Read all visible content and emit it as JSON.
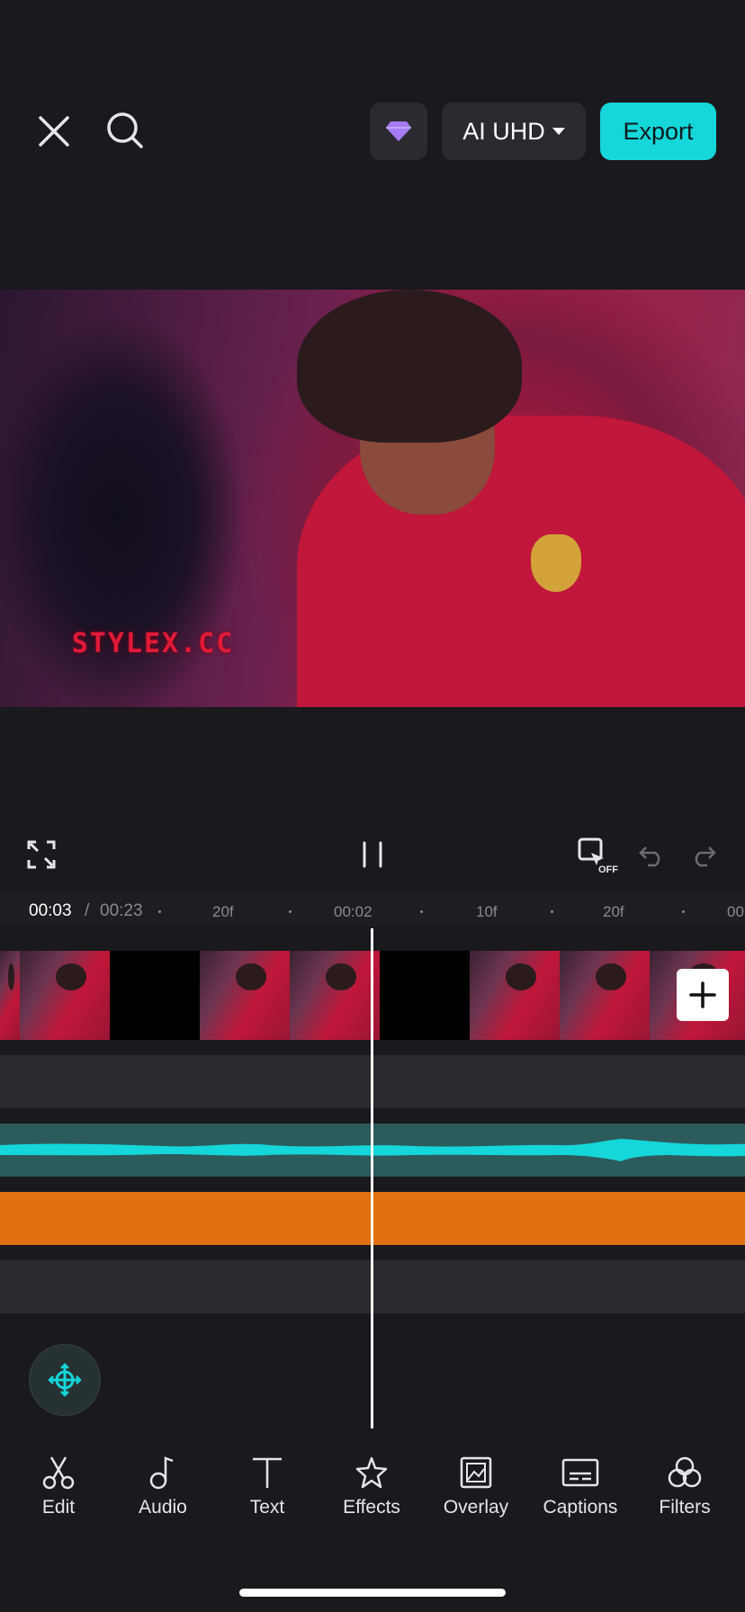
{
  "header": {
    "close_icon": "close-icon",
    "search_icon": "search-icon",
    "pro_icon": "diamond-icon",
    "quality_label": "AI UHD",
    "export_label": "Export"
  },
  "preview": {
    "watermark_text": "STYLEX.CC"
  },
  "playback": {
    "fullscreen_icon": "fullscreen-icon",
    "pause_icon": "pause-icon",
    "keyframe_toggle_icon": "keyframe-off-icon",
    "keyframe_toggle_state": "OFF",
    "undo_icon": "undo-icon",
    "redo_icon": "redo-icon"
  },
  "timeline": {
    "current_time": "00:03",
    "separator": "/",
    "total_time": "00:23",
    "ruler_labels": [
      "20f",
      "00:02",
      "10f",
      "20f",
      "00"
    ]
  },
  "toolbar": {
    "items": [
      {
        "label": "Edit",
        "icon": "scissors-icon"
      },
      {
        "label": "Audio",
        "icon": "music-note-icon"
      },
      {
        "label": "Text",
        "icon": "text-icon"
      },
      {
        "label": "Effects",
        "icon": "star-icon"
      },
      {
        "label": "Overlay",
        "icon": "overlay-icon"
      },
      {
        "label": "Captions",
        "icon": "captions-icon"
      },
      {
        "label": "Filters",
        "icon": "filters-icon"
      }
    ]
  },
  "colors": {
    "accent": "#15d6d9",
    "background": "#1a191e",
    "audio_track": "#2c5b5c",
    "orange_track": "#e1700e",
    "pro_diamond": "#a57cf5"
  }
}
